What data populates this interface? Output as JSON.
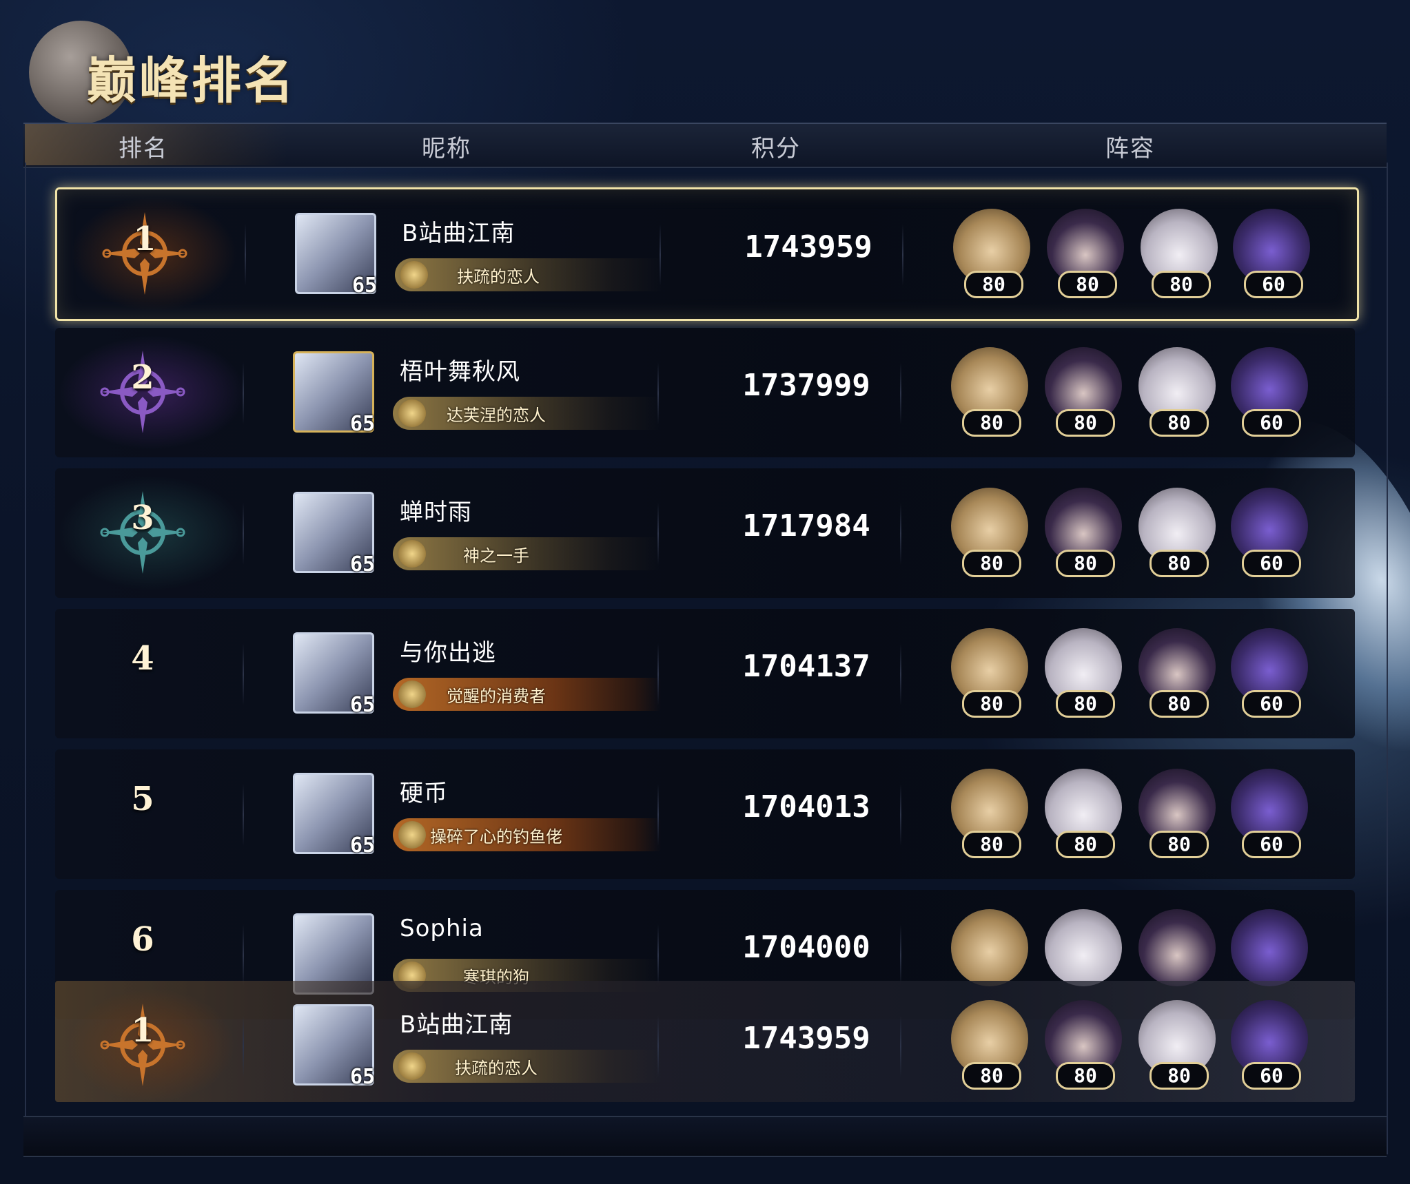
{
  "title": "巅峰排名",
  "columns": {
    "rank": "排名",
    "name": "昵称",
    "score": "积分",
    "lineup": "阵容"
  },
  "rows": [
    {
      "rank": "1",
      "name": "B站曲江南",
      "level": "65",
      "badge": "扶疏的恋人",
      "score": "1743959",
      "heroes": [
        {
          "type": "h-blonde",
          "lv": "80"
        },
        {
          "type": "h-dark",
          "lv": "80"
        },
        {
          "type": "h-silver",
          "lv": "80"
        },
        {
          "type": "h-dragon",
          "lv": "60"
        }
      ]
    },
    {
      "rank": "2",
      "name": "梧叶舞秋风",
      "level": "65",
      "badge": "达芙涅的恋人",
      "score": "1737999",
      "heroes": [
        {
          "type": "h-blonde",
          "lv": "80"
        },
        {
          "type": "h-dark",
          "lv": "80"
        },
        {
          "type": "h-silver",
          "lv": "80"
        },
        {
          "type": "h-dragon",
          "lv": "60"
        }
      ]
    },
    {
      "rank": "3",
      "name": "蝉时雨",
      "level": "65",
      "badge": "神之一手",
      "score": "1717984",
      "heroes": [
        {
          "type": "h-blonde",
          "lv": "80"
        },
        {
          "type": "h-dark",
          "lv": "80"
        },
        {
          "type": "h-silver",
          "lv": "80"
        },
        {
          "type": "h-dragon",
          "lv": "60"
        }
      ]
    },
    {
      "rank": "4",
      "name": "与你出逃",
      "level": "65",
      "badge": "觉醒的消费者",
      "score": "1704137",
      "heroes": [
        {
          "type": "h-blonde",
          "lv": "80"
        },
        {
          "type": "h-silver",
          "lv": "80"
        },
        {
          "type": "h-dark",
          "lv": "80"
        },
        {
          "type": "h-dragon",
          "lv": "60"
        }
      ]
    },
    {
      "rank": "5",
      "name": "硬币",
      "level": "65",
      "badge": "操碎了心的钓鱼佬",
      "score": "1704013",
      "heroes": [
        {
          "type": "h-blonde",
          "lv": "80"
        },
        {
          "type": "h-silver",
          "lv": "80"
        },
        {
          "type": "h-dark",
          "lv": "80"
        },
        {
          "type": "h-dragon",
          "lv": "60"
        }
      ]
    },
    {
      "rank": "6",
      "name": "Sophia",
      "level": "",
      "badge": "寒琪的狗",
      "score": "1704000",
      "heroes": [
        {
          "type": "h-blonde",
          "lv": ""
        },
        {
          "type": "h-silver",
          "lv": ""
        },
        {
          "type": "h-dark",
          "lv": ""
        },
        {
          "type": "h-dragon",
          "lv": ""
        }
      ]
    }
  ],
  "my_rank": {
    "rank": "1",
    "name": "B站曲江南",
    "level": "65",
    "badge": "扶疏的恋人",
    "score": "1743959",
    "heroes": [
      {
        "type": "h-blonde",
        "lv": "80"
      },
      {
        "type": "h-dark",
        "lv": "80"
      },
      {
        "type": "h-silver",
        "lv": "80"
      },
      {
        "type": "h-dragon",
        "lv": "60"
      }
    ]
  },
  "colors": {
    "accent_gold": "#f1e3a8",
    "rank1": "#c0702a",
    "rank2": "#7a48b0",
    "rank3": "#3f8a8a"
  }
}
